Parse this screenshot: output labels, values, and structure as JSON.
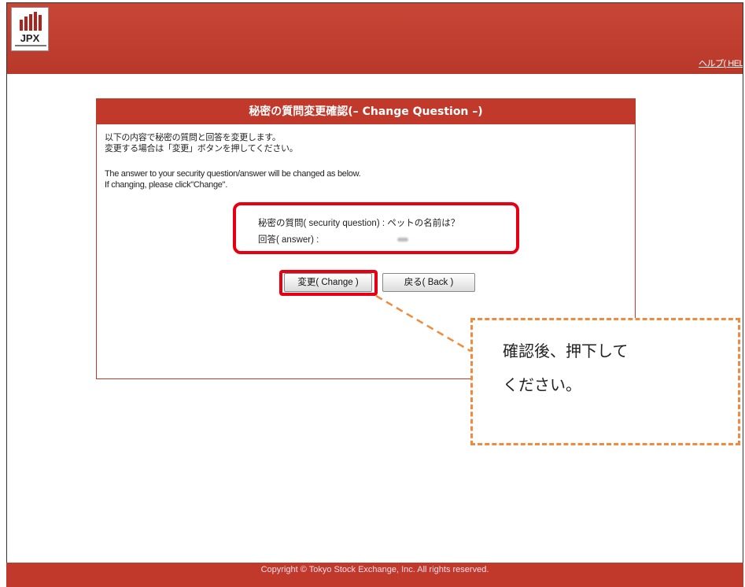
{
  "header": {
    "logo_text": "JPX",
    "help_link": "ヘルプ( HELP"
  },
  "panel": {
    "title": "秘密の質問変更確認(– Change Question –)",
    "message_jp_line1": "以下の内容で秘密の質問と回答を変更します。",
    "message_jp_line2": "変更する場合は「変更」ボタンを押してください。",
    "message_en_line1": "The answer to your security question/answer will be changed as below.",
    "message_en_line2": "If changing, please click\"Change\".",
    "question_label": "秘密の質問( security question) : ペットの名前は？",
    "answer_label": "回答( answer) :",
    "change_button": "変更( Change )",
    "back_button": "戻る( Back )"
  },
  "callout": {
    "line1": "確認後、押下して",
    "line2": "ください。"
  },
  "footer": {
    "copyright": "Copyright © Tokyo Stock Exchange, Inc. All rights reserved."
  },
  "colors": {
    "brand_red": "#c0392b",
    "highlight_red": "#e60012",
    "callout_orange": "#f08a3c"
  }
}
